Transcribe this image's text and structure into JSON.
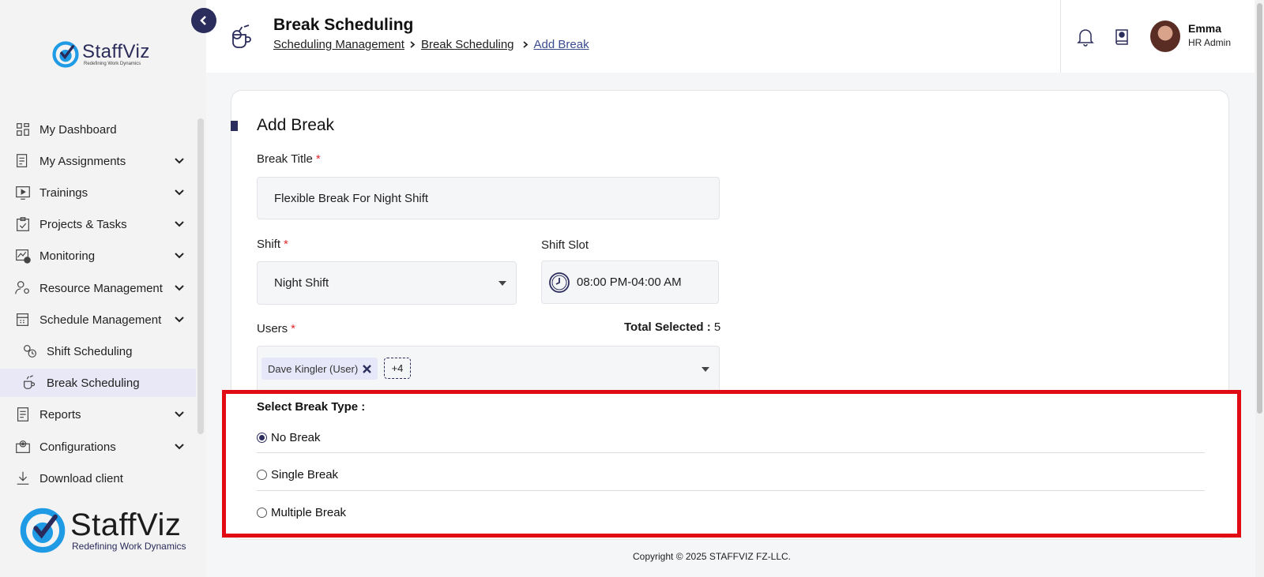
{
  "brand": {
    "name": "StaffViz",
    "tagline_small": "Redefining Work Dynamics",
    "tagline_large": "Redefining Work Dynamics"
  },
  "sidebar": {
    "items": [
      {
        "label": "My Dashboard",
        "icon": "dashboard-icon",
        "has_chevron": false
      },
      {
        "label": "My Assignments",
        "icon": "assignments-icon",
        "has_chevron": true
      },
      {
        "label": "Trainings",
        "icon": "training-icon",
        "has_chevron": true
      },
      {
        "label": "Projects & Tasks",
        "icon": "clipboard-icon",
        "has_chevron": true
      },
      {
        "label": "Monitoring",
        "icon": "monitoring-icon",
        "has_chevron": true
      },
      {
        "label": "Resource Management",
        "icon": "resource-icon",
        "has_chevron": true
      },
      {
        "label": "Schedule Management",
        "icon": "calendar-icon",
        "has_chevron": true
      },
      {
        "label": "Shift Scheduling",
        "icon": "shift-icon",
        "has_chevron": false
      },
      {
        "label": "Break Scheduling",
        "icon": "break-icon",
        "has_chevron": false
      },
      {
        "label": "Reports",
        "icon": "reports-icon",
        "has_chevron": true
      },
      {
        "label": "Configurations",
        "icon": "config-icon",
        "has_chevron": true
      },
      {
        "label": "Download client",
        "icon": "download-icon",
        "has_chevron": false
      }
    ]
  },
  "header": {
    "title": "Break Scheduling",
    "breadcrumb": [
      "Scheduling Management",
      "Break Scheduling",
      "Add Break"
    ],
    "user": {
      "name": "Emma",
      "role": "HR Admin"
    }
  },
  "form": {
    "section_title": "Add Break",
    "break_title_label": "Break Title",
    "break_title_value": "Flexible Break For Night Shift",
    "shift_label": "Shift",
    "shift_value": "Night Shift",
    "shift_slot_label": "Shift Slot",
    "shift_slot_value": "08:00 PM-04:00 AM",
    "users_label": "Users",
    "total_selected_label": "Total Selected :",
    "total_selected_value": "5",
    "user_chip": "Dave Kingler (User)",
    "more_count": "+4",
    "break_type_label": "Select Break Type :",
    "break_types": [
      {
        "label": "No Break",
        "checked": true
      },
      {
        "label": "Single Break",
        "checked": false
      },
      {
        "label": "Multiple Break",
        "checked": false
      }
    ]
  },
  "footer": {
    "copyright": "Copyright © 2025 STAFFVIZ FZ-LLC."
  },
  "colors": {
    "accent": "#2b2d5c",
    "required": "#e0292f",
    "highlight": "#e00b13",
    "active_bg": "#e8e8f7"
  }
}
